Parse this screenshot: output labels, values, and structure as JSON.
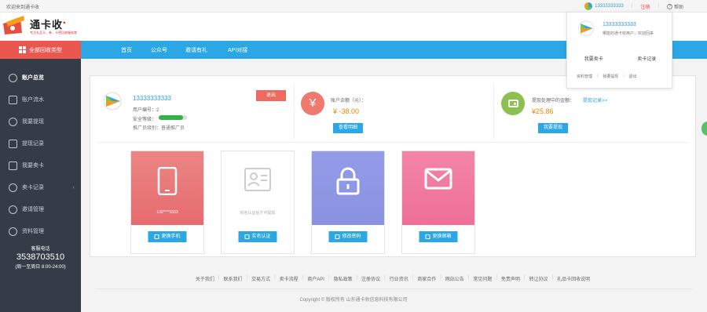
{
  "top": {
    "welcome": "欢迎来到通卡收",
    "account": "13333333333",
    "logout": "注销",
    "help": "帮助"
  },
  "logo": {
    "name": "通卡收",
    "slogan": "专注礼品卡、券、卡密回收服务商"
  },
  "allcat": "全部回收类型",
  "nav": [
    "首页",
    "公众号",
    "邀请有礼",
    "API对接"
  ],
  "sidebar": {
    "items": [
      {
        "label": "账户总览",
        "icon": "clock-icon"
      },
      {
        "label": "账户流水",
        "icon": "chart-icon"
      },
      {
        "label": "我要提现",
        "icon": "coin-icon"
      },
      {
        "label": "提现记录",
        "icon": "list-icon"
      },
      {
        "label": "我要卖卡",
        "icon": "card-icon"
      },
      {
        "label": "卖卡记录",
        "icon": "clock-icon"
      },
      {
        "label": "邀请管理",
        "icon": "user-icon"
      },
      {
        "label": "资料管理",
        "icon": "user-icon"
      }
    ],
    "hotline_label": "客服电话",
    "hotline_number": "3538703510",
    "hotline_hours": "(周一至周日 8:00-24:00)"
  },
  "user": {
    "account": "13333333333",
    "id_line": "用户编号：2",
    "security_label": "安全等级：",
    "security_level": 0.85,
    "promo_line": "推广员级别：普通推广员",
    "exit": "退出"
  },
  "balance": {
    "label": "账户余额（元）：",
    "value": "¥ -38.00",
    "button": "查看明细"
  },
  "withdraw": {
    "label": "提现处理中的金额：",
    "link": "提现记录>>",
    "value": "¥25.86",
    "button": "我要提现"
  },
  "tiles": [
    {
      "caption": "133****3333",
      "button": "更换手机",
      "color": "#ec7876"
    },
    {
      "caption": "实名认证后才可提现",
      "button": "实名认证",
      "color": "#ffffff"
    },
    {
      "caption": "",
      "button": "修改密码",
      "color": "#8f98e4"
    },
    {
      "caption": "",
      "button": "更换邮箱",
      "color": "#f0769c"
    }
  ],
  "footer": {
    "links": [
      "关于我们",
      "联系我们",
      "交易方式",
      "卖卡流程",
      "商户API",
      "隐私政策",
      "注册协议",
      "行业资讯",
      "商家合作",
      "网站公告",
      "常见问题",
      "免责声明",
      "转让协议",
      "礼品卡回收说明"
    ],
    "copyright": "Copyright © 版权所有 山东通卡收信息科技有限公司"
  },
  "popover": {
    "account": "13333333333",
    "greeting": "哪能的通卡收用户，欢迎回来",
    "sell": "我要卖卡",
    "records": "卖卡记录",
    "profile": "资料管理",
    "withdraw": "我要提现",
    "exit": "退出"
  },
  "colors": {
    "accent": "#2ca7e6",
    "sidebar": "#353c47",
    "red": "#e9574f",
    "amount": "#ee8a00"
  }
}
